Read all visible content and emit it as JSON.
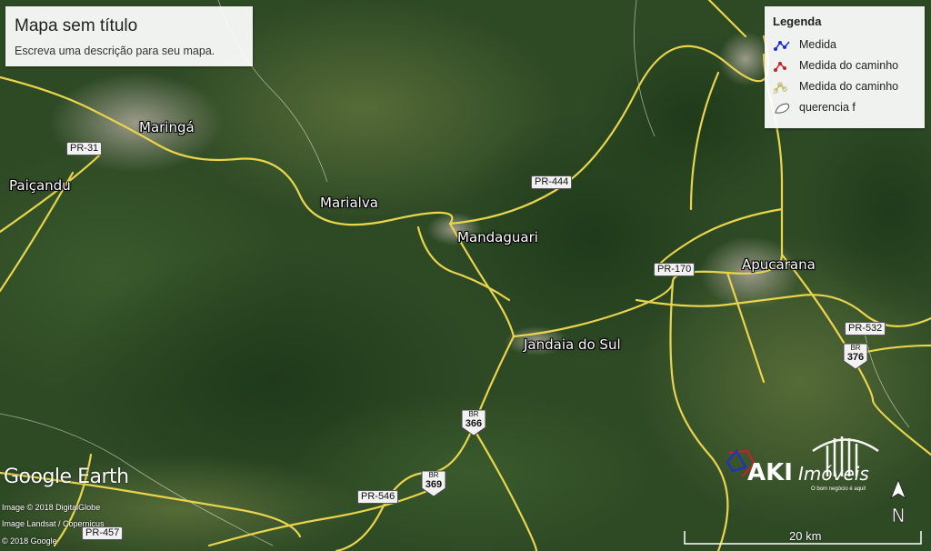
{
  "map": {
    "title": "Mapa sem título",
    "description": "Escreva uma descrição para seu mapa.",
    "cities": [
      {
        "name": "Maringá"
      },
      {
        "name": "Paiçandu"
      },
      {
        "name": "Marialva"
      },
      {
        "name": "Mandaguari"
      },
      {
        "name": "Apucarana"
      },
      {
        "name": "Jandaia do Sul"
      }
    ],
    "road_labels": [
      "PR-31",
      "PR-444",
      "PR-170",
      "PR-532",
      "PR-546",
      "PR-457"
    ],
    "br_shields": [
      {
        "top": "BR",
        "num": "376"
      },
      {
        "top": "BR",
        "num": "366"
      },
      {
        "top": "BR",
        "num": "369"
      }
    ]
  },
  "legend": {
    "title": "Legenda",
    "items": [
      {
        "label": "Medida",
        "icon": "blue-path-icon",
        "color": "#1a2fd6"
      },
      {
        "label": "Medida do caminho",
        "icon": "red-path-icon",
        "color": "#c8202a"
      },
      {
        "label": "Medida do caminho",
        "icon": "yellow-path-icon",
        "color": "#d9d16a"
      },
      {
        "label": "querencia f",
        "icon": "polygon-icon",
        "color": "#ffffff"
      }
    ]
  },
  "branding": {
    "google_earth": "Google Earth",
    "credits": [
      "Image © 2018 DigitalGlobe",
      "Image Landsat / Copernicus",
      "© 2018 Google"
    ]
  },
  "scale": {
    "label": "20 km"
  },
  "compass": {
    "letter": "N"
  },
  "watermark": {
    "name": "AKI Imóveis",
    "slogan": "O bom negócio é aqui!"
  },
  "colors": {
    "road": "#e8d44d",
    "border": "#ffffff",
    "measure_blue": "#1a2fd6",
    "measure_red": "#c8202a"
  }
}
